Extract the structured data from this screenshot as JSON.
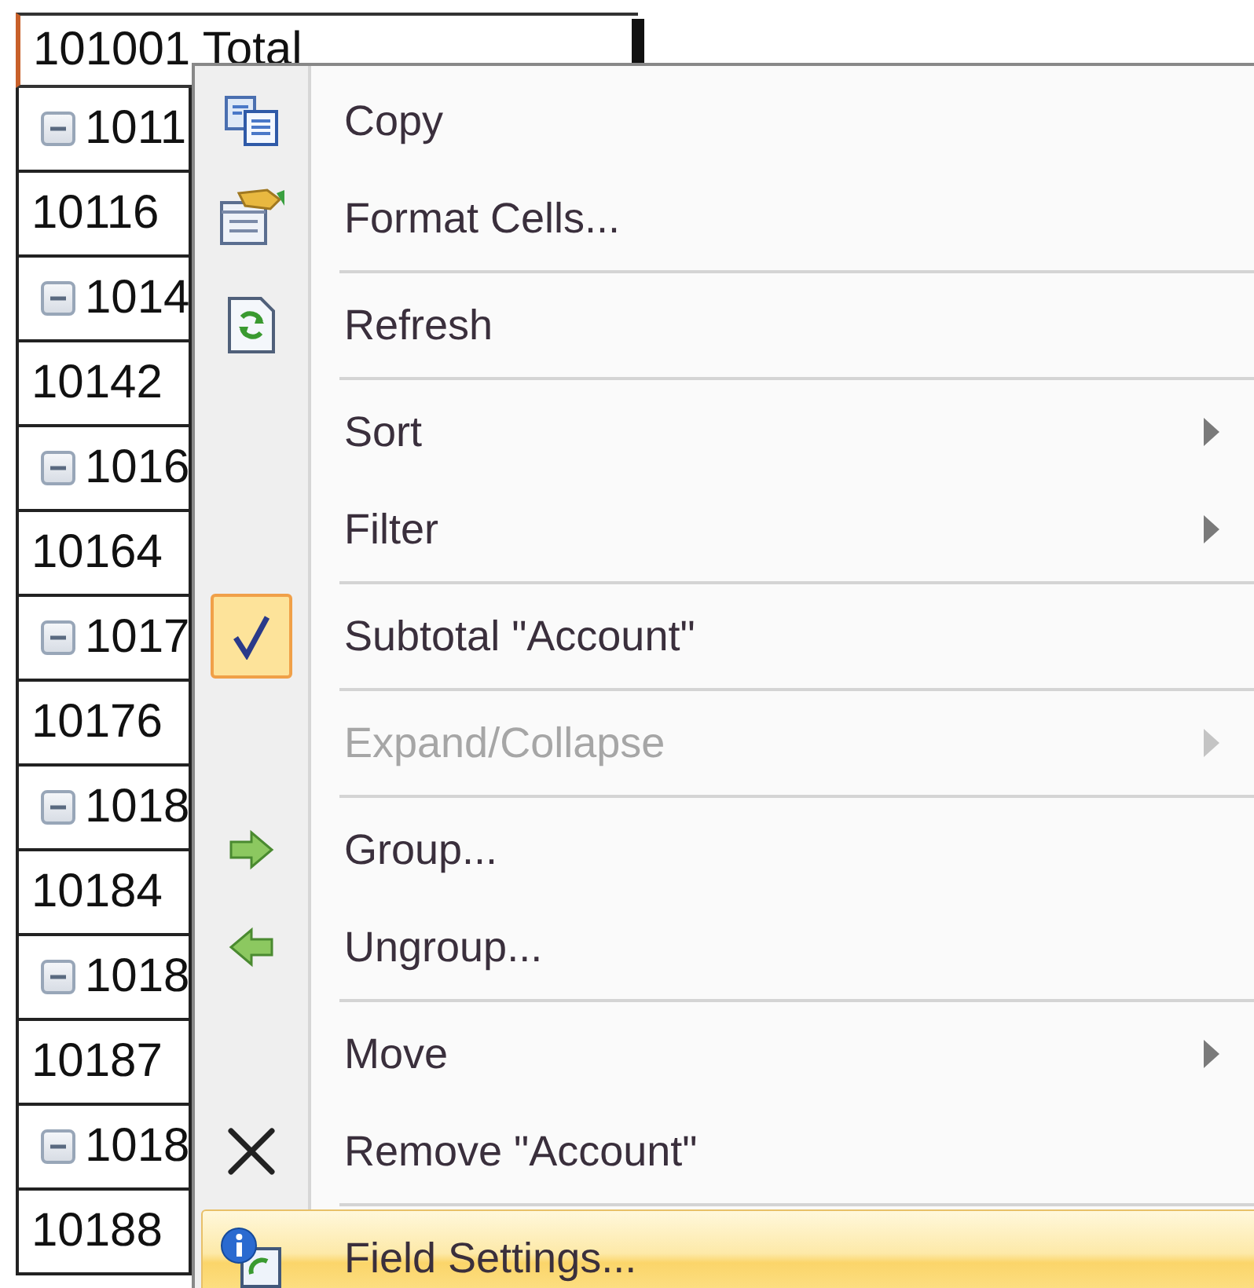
{
  "sheet": {
    "header_cell": "101001 Total",
    "rows": [
      {
        "kind": "group",
        "text": "1011",
        "expanded": true
      },
      {
        "kind": "item",
        "text": "10116"
      },
      {
        "kind": "group",
        "text": "1014",
        "expanded": true
      },
      {
        "kind": "item",
        "text": "10142"
      },
      {
        "kind": "group",
        "text": "1016",
        "expanded": true
      },
      {
        "kind": "item",
        "text": "10164"
      },
      {
        "kind": "group",
        "text": "1017",
        "expanded": true
      },
      {
        "kind": "item",
        "text": "10176"
      },
      {
        "kind": "group",
        "text": "1018",
        "expanded": true
      },
      {
        "kind": "item",
        "text": "10184"
      },
      {
        "kind": "group",
        "text": "1018",
        "expanded": true
      },
      {
        "kind": "item",
        "text": "10187"
      },
      {
        "kind": "group",
        "text": "1018",
        "expanded": true
      },
      {
        "kind": "item",
        "text": "10188"
      }
    ]
  },
  "context_menu": {
    "groups": [
      [
        {
          "label": "Copy",
          "checked": false,
          "disabled": false,
          "submenu": false,
          "selected": false
        },
        {
          "label": "Format Cells...",
          "checked": false,
          "disabled": false,
          "submenu": false,
          "selected": false
        }
      ],
      [
        {
          "label": "Refresh",
          "checked": false,
          "disabled": false,
          "submenu": false,
          "selected": false
        }
      ],
      [
        {
          "label": "Sort",
          "checked": false,
          "disabled": false,
          "submenu": true,
          "selected": false
        },
        {
          "label": "Filter",
          "checked": false,
          "disabled": false,
          "submenu": true,
          "selected": false
        }
      ],
      [
        {
          "label": "Subtotal \"Account\"",
          "checked": true,
          "disabled": false,
          "submenu": false,
          "selected": false
        }
      ],
      [
        {
          "label": "Expand/Collapse",
          "checked": false,
          "disabled": true,
          "submenu": true,
          "selected": false
        }
      ],
      [
        {
          "label": "Group...",
          "checked": false,
          "disabled": false,
          "submenu": false,
          "selected": false
        },
        {
          "label": "Ungroup...",
          "checked": false,
          "disabled": false,
          "submenu": false,
          "selected": false
        }
      ],
      [
        {
          "label": "Move",
          "checked": false,
          "disabled": false,
          "submenu": true,
          "selected": false
        },
        {
          "label": "Remove \"Account\"",
          "checked": false,
          "disabled": false,
          "submenu": false,
          "selected": false
        }
      ],
      [
        {
          "label": "Field Settings...",
          "checked": false,
          "disabled": false,
          "submenu": false,
          "selected": true
        }
      ]
    ]
  }
}
